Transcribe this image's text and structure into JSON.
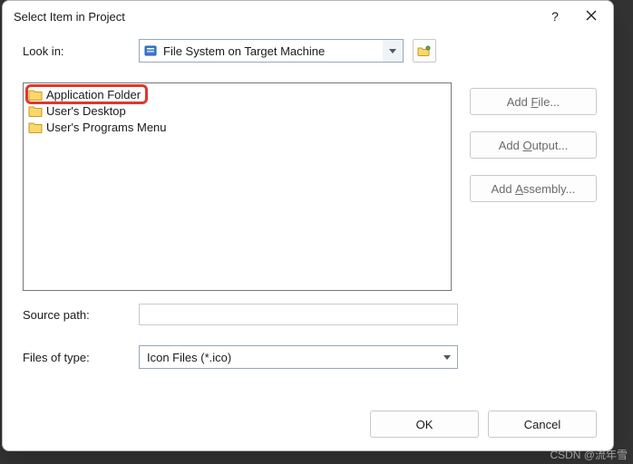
{
  "title": "Select Item in Project",
  "lookin": {
    "label": "Look in:",
    "selected": "File System on Target Machine"
  },
  "tree": {
    "items": [
      {
        "label": "Application Folder",
        "highlight": true
      },
      {
        "label": "User's Desktop"
      },
      {
        "label": "User's Programs Menu"
      }
    ]
  },
  "sideButtons": {
    "addFile": "Add File...",
    "addOutput": "Add Output...",
    "addAssembly": "Add Assembly..."
  },
  "source": {
    "label": "Source path:",
    "value": ""
  },
  "filesOfType": {
    "label": "Files of type:",
    "selected": "Icon Files (*.ico)"
  },
  "footer": {
    "ok": "OK",
    "cancel": "Cancel"
  },
  "watermark": "CSDN @流年雪"
}
